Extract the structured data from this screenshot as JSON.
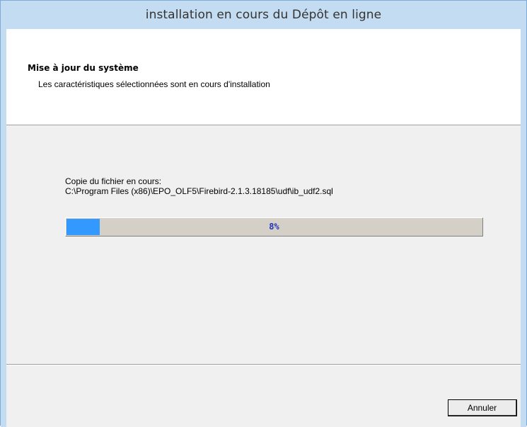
{
  "window": {
    "title": "installation en cours du Dépôt en ligne"
  },
  "header": {
    "title": "Mise à jour du système",
    "subtitle": "Les caractéristiques sélectionnées sont en cours d'installation"
  },
  "progress": {
    "status_label": "Copie du fichier en cours:",
    "file_path": "C:\\Program Files (x86)\\EPO_OLF5\\Firebird-2.1.3.18185\\udf\\ib_udf2.sql",
    "percent": 8,
    "percent_text": "8%"
  },
  "actions": {
    "cancel_label": "Annuler"
  },
  "colors": {
    "titlebar": "#c4dcf2",
    "progress_fill": "#3399ff",
    "progress_text": "#2233bb",
    "panel_bg": "#f0f0f0"
  }
}
